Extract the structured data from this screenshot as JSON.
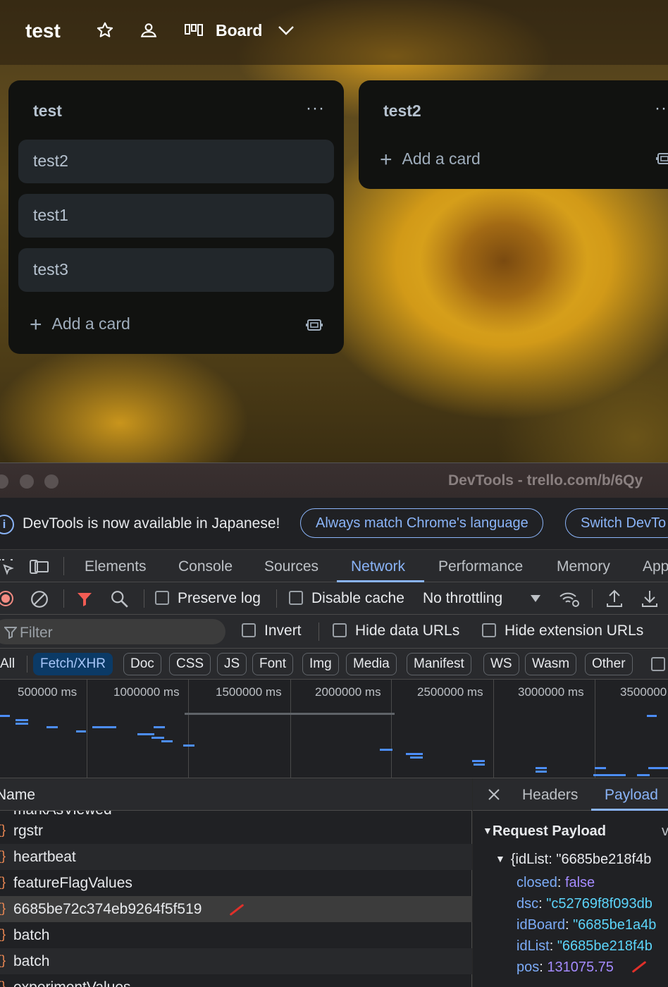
{
  "board": {
    "title": "test",
    "view_label": "Board"
  },
  "lists": [
    {
      "title": "test",
      "cards": [
        "test2",
        "test1",
        "test3"
      ],
      "add_card_label": "Add a card"
    },
    {
      "title": "test2",
      "cards": [],
      "add_card_label": "Add a card"
    }
  ],
  "devtools": {
    "window_title": "DevTools - trello.com/b/6Qy",
    "infobar": {
      "message": "DevTools is now available in Japanese!",
      "match_button": "Always match Chrome's language",
      "switch_button": "Switch DevTo"
    },
    "tabs": [
      "Elements",
      "Console",
      "Sources",
      "Network",
      "Performance",
      "Memory",
      "App"
    ],
    "active_tab": "Network",
    "toolbar": {
      "preserve_log": "Preserve log",
      "disable_cache": "Disable cache",
      "throttling": "No throttling"
    },
    "filter": {
      "placeholder": "Filter",
      "invert": "Invert",
      "hide_data_urls": "Hide data URLs",
      "hide_extension_urls": "Hide extension URLs"
    },
    "type_filters": [
      "All",
      "Fetch/XHR",
      "Doc",
      "CSS",
      "JS",
      "Font",
      "Img",
      "Media",
      "Manifest",
      "WS",
      "Wasm",
      "Other"
    ],
    "active_type_filter": "Fetch/XHR",
    "timeline_ticks": [
      "500000 ms",
      "1000000 ms",
      "1500000 ms",
      "2000000 ms",
      "2500000 ms",
      "3000000 ms",
      "3500000"
    ],
    "request_list": {
      "column_name": "Name",
      "partial_top_row": "markAsViewed",
      "rows": [
        "rgstr",
        "heartbeat",
        "featureFlagValues",
        "6685be72c374eb9264f5f519",
        "batch",
        "batch",
        "experimentValues"
      ],
      "selected_index": 3
    },
    "detail": {
      "tabs": [
        "Headers",
        "Payload"
      ],
      "active_tab": "Payload",
      "section_title": "Request Payload",
      "section_hint": "v",
      "object_summary": "{idList: \"6685be218f4b",
      "fields": [
        {
          "key": "closed",
          "value": "false",
          "kind": "bool"
        },
        {
          "key": "dsc",
          "value": "\"c52769f8f093db",
          "kind": "string"
        },
        {
          "key": "idBoard",
          "value": "\"6685be1a4b",
          "kind": "string"
        },
        {
          "key": "idList",
          "value": "\"6685be218f4b",
          "kind": "string"
        },
        {
          "key": "pos",
          "value": "131075.75",
          "kind": "number"
        }
      ]
    }
  }
}
